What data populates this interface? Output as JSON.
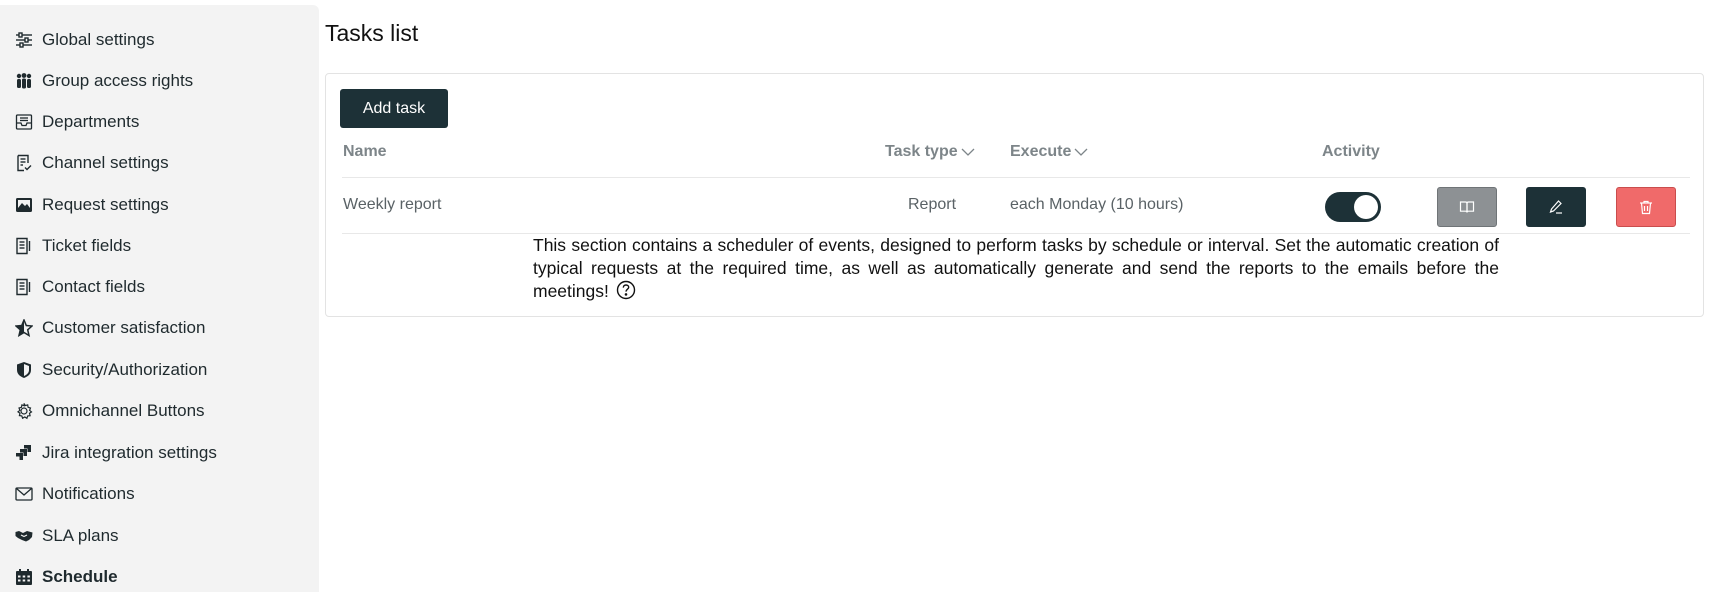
{
  "sidebar": {
    "items": [
      {
        "label": "Global settings",
        "icon": "sliders-icon",
        "active": false
      },
      {
        "label": "Group access rights",
        "icon": "users-icon",
        "active": false
      },
      {
        "label": "Departments",
        "icon": "inbox-icon",
        "active": false
      },
      {
        "label": "Channel settings",
        "icon": "list-check-icon",
        "active": false
      },
      {
        "label": "Request settings",
        "icon": "image-icon",
        "active": false
      },
      {
        "label": "Ticket fields",
        "icon": "form-icon",
        "active": false
      },
      {
        "label": "Contact fields",
        "icon": "form-icon",
        "active": false
      },
      {
        "label": "Customer satisfaction",
        "icon": "star-icon",
        "active": false
      },
      {
        "label": "Security/Authorization",
        "icon": "shield-icon",
        "active": false
      },
      {
        "label": "Omnichannel Buttons",
        "icon": "gear-icon",
        "active": false
      },
      {
        "label": "Jira integration settings",
        "icon": "jira-icon",
        "active": false
      },
      {
        "label": "Notifications",
        "icon": "envelope-icon",
        "active": false
      },
      {
        "label": "SLA plans",
        "icon": "handshake-icon",
        "active": false
      },
      {
        "label": "Schedule",
        "icon": "calendar-icon",
        "active": true
      }
    ]
  },
  "page": {
    "title": "Tasks list"
  },
  "toolbar": {
    "add_label": "Add task"
  },
  "table": {
    "columns": {
      "name": "Name",
      "task_type": "Task type",
      "execute": "Execute",
      "activity": "Activity"
    },
    "rows": [
      {
        "name": "Weekly report",
        "task_type": "Report",
        "execute": "each Monday (10 hours)",
        "active": true
      }
    ]
  },
  "info": {
    "text": "This section contains a scheduler of events, designed to perform tasks by schedule or interval. Set the automatic creation of typical requests at the required time, as well as automatically generate and send the reports to the emails before the meetings!"
  },
  "colors": {
    "primary": "#1d3137",
    "danger": "#f06a6a",
    "muted_button": "#8d9194",
    "sidebar_bg": "#f3f3f3"
  }
}
